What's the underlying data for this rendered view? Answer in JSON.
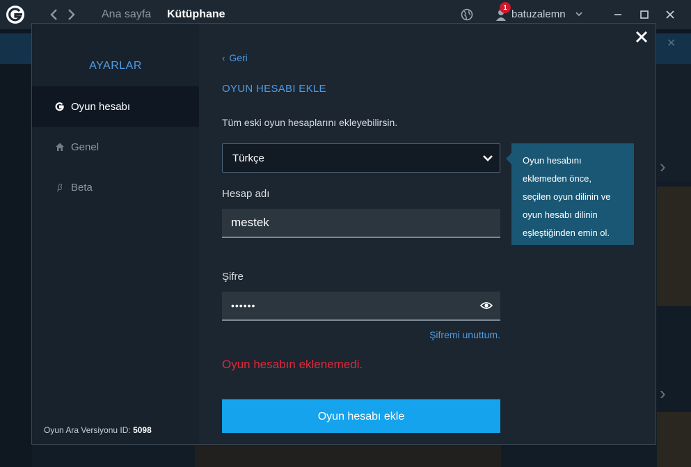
{
  "titlebar": {
    "nav_home": "Ana sayfa",
    "nav_library": "Kütüphane",
    "notification_count": "1",
    "username": "batuzalemn",
    "icons": {
      "logo": "gameforge-logo-icon",
      "back": "chevron-left-icon",
      "forward": "chevron-right-icon",
      "language": "globe-icon",
      "user": "user-icon",
      "user_menu": "chevron-down-icon",
      "minimize": "minimize-icon",
      "maximize": "maximize-icon",
      "close": "close-icon"
    }
  },
  "modal": {
    "sidebar": {
      "title": "AYARLAR",
      "items": [
        {
          "label": "Oyun hesabı",
          "icon": "gameforge-logo-icon",
          "active": true
        },
        {
          "label": "Genel",
          "icon": "home-icon",
          "active": false
        },
        {
          "label": "Beta",
          "icon": "beta-icon",
          "active": false
        }
      ],
      "version_label": "Oyun Ara Versiyonu ID:",
      "version_id": "5098"
    },
    "content": {
      "back_label": "Geri",
      "title": "OYUN HESABI EKLE",
      "description": "Tüm eski oyun hesaplarını ekleyebilirsin.",
      "language_select": "Türkçe",
      "account_label": "Hesap adı",
      "account_value": "mestek",
      "password_label": "Şifre",
      "password_value": "••••••",
      "forgot_label": "Şifremi unuttum.",
      "error_message": "Oyun hesabın eklenemedi.",
      "submit_label": "Oyun hesabı ekle",
      "tooltip": [
        "Oyun hesabını",
        "eklemeden önce,",
        "seçilen oyun dilinin ve",
        "oyun hesabı dilinin",
        "eşleştiğinden emin ol."
      ]
    }
  },
  "colors": {
    "accent": "#4d9de6",
    "button": "#14a3ec",
    "error": "#e0293a",
    "tooltip_bg": "#1a5774",
    "badge": "#d1182b"
  }
}
